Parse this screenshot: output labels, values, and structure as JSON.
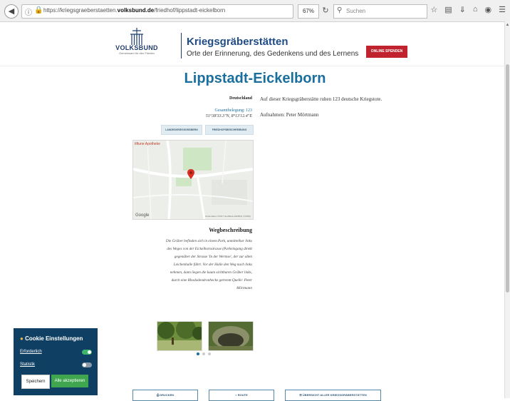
{
  "browser": {
    "url_prefix": "https://kriegsgraeberstaetten.",
    "url_domain": "volksbund.de",
    "url_path": "/friedhof/lippstadt-eickelborn",
    "zoom": "67%",
    "search_placeholder": "Suchen"
  },
  "header": {
    "logo_text": "VOLKSBUND",
    "logo_subtitle": "Gemeinsam für den Frieden",
    "title": "Kriegsgräberstätten",
    "subtitle": "Orte der Erinnerung, des Gedenkens und des Lernens",
    "donate_label": "ONLINE SPENDEN"
  },
  "main": {
    "page_title": "Lippstadt-Eickelborn",
    "country": "Deutschland",
    "burials": "Gesamtbelegung: 123",
    "coords": "51°38'33.3\"N, 8°13'12.4\"E",
    "description": "Auf dieser Kriegsgräberstätte ruhen 123 deutsche Kriegstote.",
    "photo_credit": "Aufnahmen: Peter Mörtmann",
    "btn_state_graves": "LANDESKRIEGSGRÄBERN",
    "btn_history": "FRIEDHOFSBESCHREIBUNG",
    "map_place": "tiftune Apotheke",
    "map_google": "Google",
    "map_credit": "Kartendaten ©2017 GeoBasis-DE/BKG (©2009)",
    "route_heading": "Wegbeschreibung",
    "route_text": "Die Gräber befinden sich in einem Park, unmittelbar links des Weges von der Eickelbornstrasse (Parkeingang direkt gegenüber der Strasse 'In der Wermse', der zur alten Leichenhalle führt. Vor der Halle den Weg nach links nehmen, dann liegen die kaum sichtbaren Gräber links, durch eine Rhododendronhecke getrennt.Quelle: Peter Mörtmann"
  },
  "cookie": {
    "title": "Cookie Einstellungen",
    "required_label": "Erforderlich",
    "stats_label": "Statistik",
    "save_label": "Speichern",
    "accept_all_label": "Alle akzeptieren"
  },
  "bottom": {
    "print_label": "DRUCKEN",
    "route_label": "ROUTE",
    "overview_label": "ÜBERSICHT ALLER KRIEGSGRÄBERSTÄTTEN"
  }
}
